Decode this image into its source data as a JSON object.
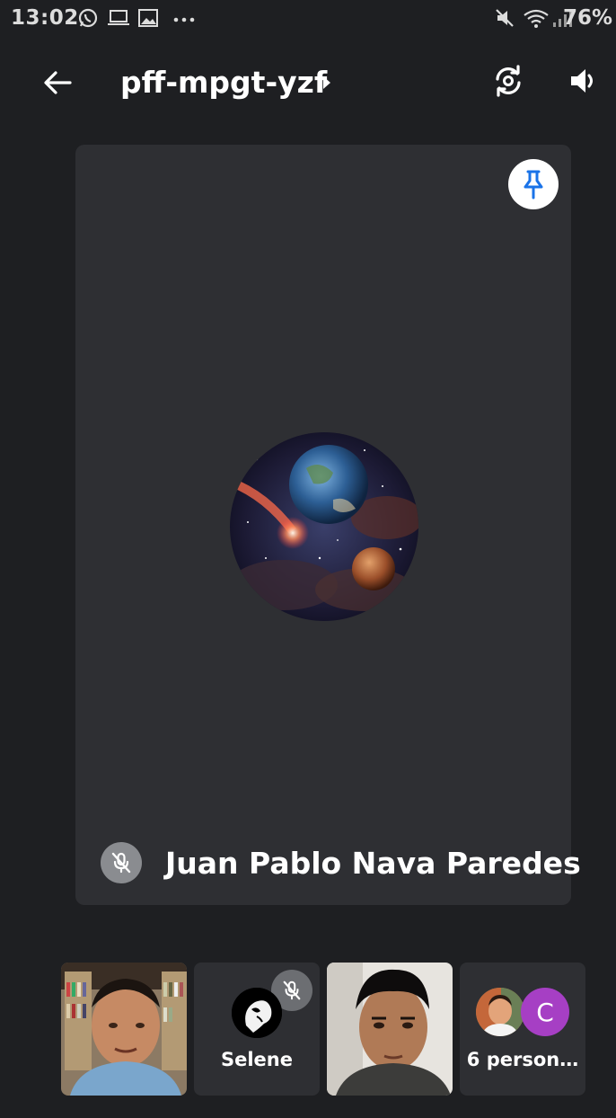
{
  "status_bar": {
    "time": "13:02",
    "battery": "76%",
    "icons": [
      "whatsapp-icon",
      "laptop-icon",
      "image-icon",
      "more-dots-icon",
      "mute-icon",
      "wifi-icon",
      "signal-icon"
    ]
  },
  "top_bar": {
    "meeting_code": "pff-mpgt-yzf"
  },
  "main_tile": {
    "participant_name": "Juan Pablo Nava Paredes",
    "muted": true,
    "pinned": false
  },
  "thumbnails": [
    {
      "type": "video"
    },
    {
      "type": "avatar",
      "name": "Selene",
      "muted": true
    },
    {
      "type": "video"
    },
    {
      "type": "overflow",
      "label": "6 person…",
      "avatar_letter": "C"
    }
  ],
  "colors": {
    "background": "#1e1f22",
    "tile": "#2e2f33",
    "pin_blue": "#1a73e8",
    "overflow_avatar": "#a63fc4"
  }
}
